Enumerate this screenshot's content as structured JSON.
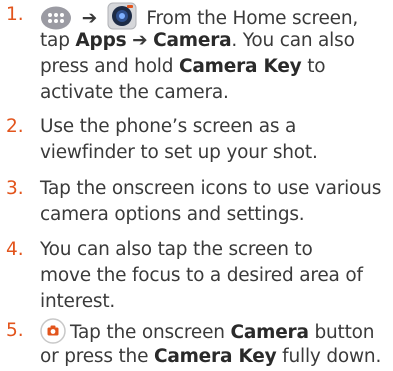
{
  "steps": [
    {
      "number": "1.",
      "arrow": "➔",
      "lines": {
        "l1_text": "From the Home screen,",
        "l2_pre": "tap ",
        "l2_apps": "Apps",
        "l2_arrow": " ➔ ",
        "l2_camera": "Camera",
        "l2_post": ". You can also",
        "l3_pre": "press and hold ",
        "l3_key": "Camera Key",
        "l3_post": " to",
        "l4": "activate the camera."
      },
      "icons": [
        "apps-icon",
        "camera-app-icon"
      ]
    },
    {
      "number": "2.",
      "lines": [
        "Use the phone’s screen as a",
        "viewfinder to set up your shot."
      ]
    },
    {
      "number": "3.",
      "lines": [
        "Tap the onscreen icons to use various",
        "camera options and settings."
      ]
    },
    {
      "number": "4.",
      "lines": [
        "You can also tap the screen to",
        "move the focus to a desired area of",
        "interest."
      ]
    },
    {
      "number": "5.",
      "lines": {
        "l1_text": "Tap the onscreen ",
        "l1_bold": "Camera",
        "l1_post": " button",
        "l2_pre": "or press the ",
        "l2_bold": "Camera Key",
        "l2_post": " fully down."
      },
      "icons": [
        "shutter-button-icon"
      ]
    }
  ],
  "colors": {
    "accent": "#e2541c",
    "text": "#3a3a3a"
  }
}
